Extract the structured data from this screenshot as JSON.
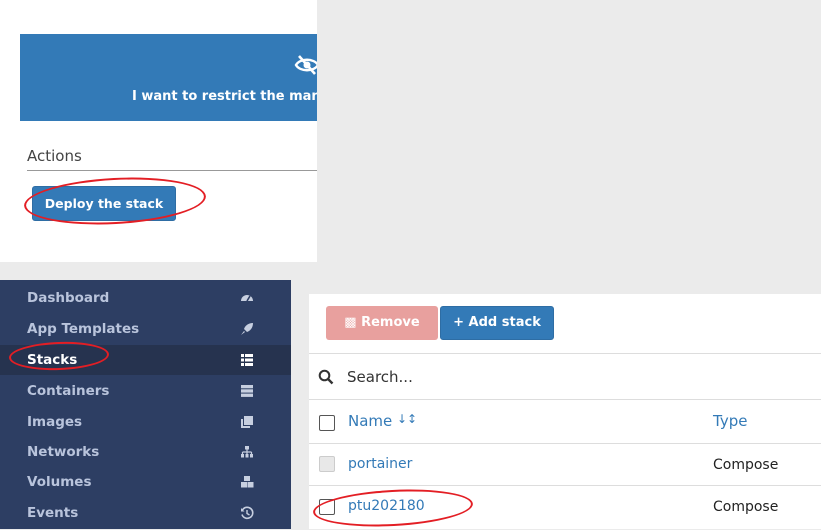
{
  "access_control": {
    "text": "I want to restrict the manage",
    "icon": "eye-slash-icon"
  },
  "actions": {
    "title": "Actions",
    "deploy_label": "Deploy the stack"
  },
  "sidebar": {
    "items": [
      {
        "label": "Dashboard",
        "icon": "tachometer-icon"
      },
      {
        "label": "App Templates",
        "icon": "rocket-icon"
      },
      {
        "label": "Stacks",
        "icon": "th-list-icon",
        "active": true
      },
      {
        "label": "Containers",
        "icon": "server-icon"
      },
      {
        "label": "Images",
        "icon": "clone-icon"
      },
      {
        "label": "Networks",
        "icon": "sitemap-icon"
      },
      {
        "label": "Volumes",
        "icon": "cubes-icon"
      },
      {
        "label": "Events",
        "icon": "history-icon"
      }
    ]
  },
  "stacks": {
    "remove_label": "Remove",
    "add_label": "+ Add stack",
    "search_placeholder": "Search...",
    "columns": {
      "name": "Name",
      "type": "Type"
    },
    "rows": [
      {
        "name": "portainer",
        "type": "Compose",
        "selectable": false
      },
      {
        "name": "ptu202180",
        "type": "Compose",
        "selectable": true
      }
    ]
  },
  "colors": {
    "primary": "#337ab7",
    "danger_disabled": "#e8a09e",
    "sidebar_bg": "#2d3e63",
    "annotation": "#e31e24"
  }
}
